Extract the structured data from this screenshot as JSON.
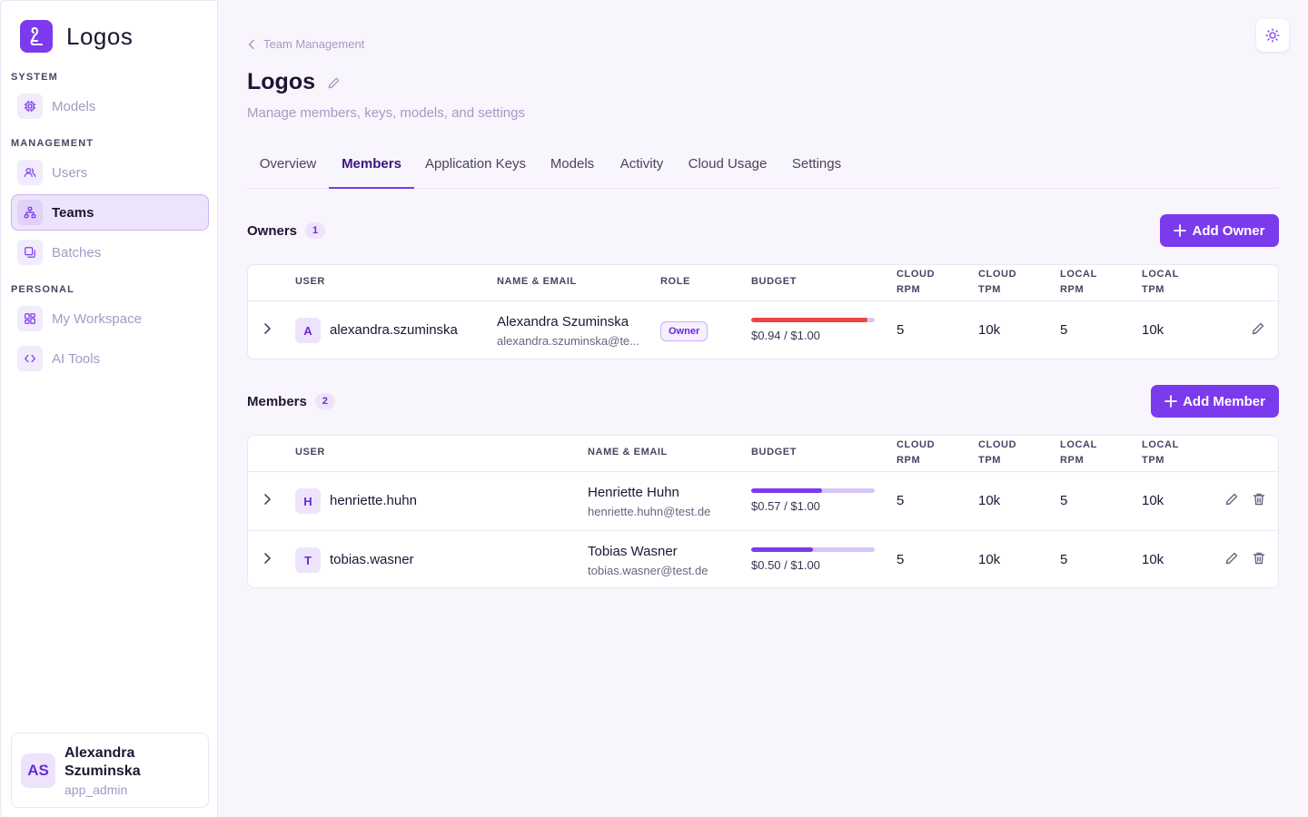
{
  "app": {
    "name": "Logos"
  },
  "sidebar": {
    "sections": [
      {
        "label": "SYSTEM"
      },
      {
        "label": "MANAGEMENT"
      },
      {
        "label": "PERSONAL"
      }
    ],
    "items": [
      {
        "label": "Models",
        "icon": "chip-icon"
      },
      {
        "label": "Users",
        "icon": "users-icon"
      },
      {
        "label": "Teams",
        "icon": "teams-icon",
        "active": true
      },
      {
        "label": "Batches",
        "icon": "batches-icon"
      },
      {
        "label": "My Workspace",
        "icon": "workspace-icon"
      },
      {
        "label": "AI Tools",
        "icon": "code-icon"
      }
    ],
    "user": {
      "initials": "AS",
      "name": "Alexandra Szuminska",
      "role": "app_admin"
    }
  },
  "breadcrumb": {
    "label": "Team Management"
  },
  "page": {
    "title": "Logos",
    "subtitle": "Manage members, keys, models, and settings"
  },
  "tabs": [
    {
      "label": "Overview"
    },
    {
      "label": "Members",
      "active": true
    },
    {
      "label": "Application Keys"
    },
    {
      "label": "Models"
    },
    {
      "label": "Activity"
    },
    {
      "label": "Cloud Usage"
    },
    {
      "label": "Settings"
    }
  ],
  "owners": {
    "title": "Owners",
    "count": "1",
    "add_label": "Add Owner",
    "columns": {
      "user": "USER",
      "name_email": "NAME & EMAIL",
      "role": "ROLE",
      "budget": "BUDGET",
      "cloud_rpm_1": "CLOUD",
      "cloud_rpm_2": "RPM",
      "cloud_tpm_1": "CLOUD",
      "cloud_tpm_2": "TPM",
      "local_rpm_1": "LOCAL",
      "local_rpm_2": "RPM",
      "local_tpm_1": "LOCAL",
      "local_tpm_2": "TPM"
    },
    "rows": [
      {
        "initial": "A",
        "username": "alexandra.szuminska",
        "name": "Alexandra Szuminska",
        "email": "alexandra.szuminska@te...",
        "role": "Owner",
        "budget": "$0.94 / $1.00",
        "budget_fraction": 0.94,
        "budget_color": "#ef4444",
        "cloud_rpm": "5",
        "cloud_tpm": "10k",
        "local_rpm": "5",
        "local_tpm": "10k"
      }
    ]
  },
  "members": {
    "title": "Members",
    "count": "2",
    "add_label": "Add Member",
    "columns": {
      "user": "USER",
      "name_email": "NAME & EMAIL",
      "budget": "BUDGET",
      "cloud_rpm_1": "CLOUD",
      "cloud_rpm_2": "RPM",
      "cloud_tpm_1": "CLOUD",
      "cloud_tpm_2": "TPM",
      "local_rpm_1": "LOCAL",
      "local_rpm_2": "RPM",
      "local_tpm_1": "LOCAL",
      "local_tpm_2": "TPM"
    },
    "rows": [
      {
        "initial": "H",
        "username": "henriette.huhn",
        "name": "Henriette Huhn",
        "email": "henriette.huhn@test.de",
        "budget": "$0.57 / $1.00",
        "budget_fraction": 0.57,
        "budget_color": "#7c3aed",
        "cloud_rpm": "5",
        "cloud_tpm": "10k",
        "local_rpm": "5",
        "local_tpm": "10k"
      },
      {
        "initial": "T",
        "username": "tobias.wasner",
        "name": "Tobias Wasner",
        "email": "tobias.wasner@test.de",
        "budget": "$0.50 / $1.00",
        "budget_fraction": 0.5,
        "budget_color": "#7c3aed",
        "cloud_rpm": "5",
        "cloud_tpm": "10k",
        "local_rpm": "5",
        "local_tpm": "10k"
      }
    ]
  }
}
